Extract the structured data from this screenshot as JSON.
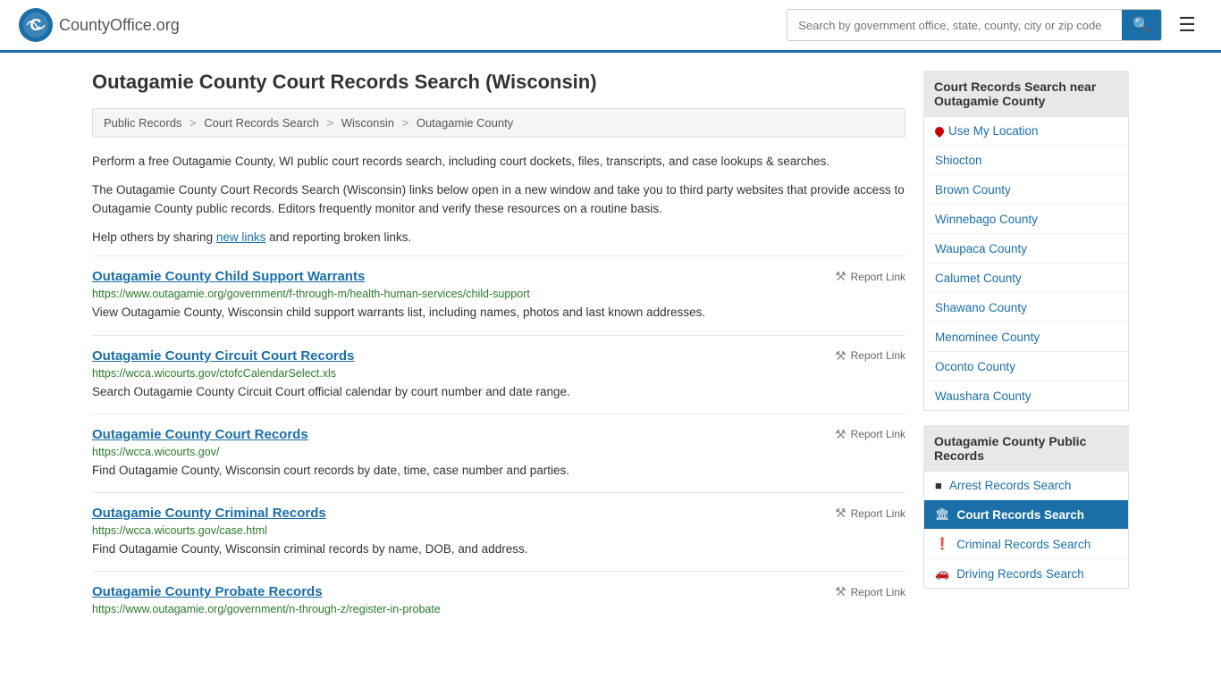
{
  "header": {
    "logo_text": "CountyOffice",
    "logo_suffix": ".org",
    "search_placeholder": "Search by government office, state, county, city or zip code",
    "search_value": ""
  },
  "page": {
    "title": "Outagamie County Court Records Search (Wisconsin)",
    "description1": "Perform a free Outagamie County, WI public court records search, including court dockets, files, transcripts, and case lookups & searches.",
    "description2": "The Outagamie County Court Records Search (Wisconsin) links below open in a new window and take you to third party websites that provide access to Outagamie County public records. Editors frequently monitor and verify these resources on a routine basis.",
    "description3_pre": "Help others by sharing ",
    "description3_link": "new links",
    "description3_post": " and reporting broken links."
  },
  "breadcrumb": {
    "items": [
      "Public Records",
      "Court Records Search",
      "Wisconsin",
      "Outagamie County"
    ]
  },
  "links": [
    {
      "title": "Outagamie County Child Support Warrants",
      "url": "https://www.outagamie.org/government/f-through-m/health-human-services/child-support",
      "description": "View Outagamie County, Wisconsin child support warrants list, including names, photos and last known addresses.",
      "report": "Report Link"
    },
    {
      "title": "Outagamie County Circuit Court Records",
      "url": "https://wcca.wicourts.gov/ctofcCalendarSelect.xls",
      "description": "Search Outagamie County Circuit Court official calendar by court number and date range.",
      "report": "Report Link"
    },
    {
      "title": "Outagamie County Court Records",
      "url": "https://wcca.wicourts.gov/",
      "description": "Find Outagamie County, Wisconsin court records by date, time, case number and parties.",
      "report": "Report Link"
    },
    {
      "title": "Outagamie County Criminal Records",
      "url": "https://wcca.wicourts.gov/case.html",
      "description": "Find Outagamie County, Wisconsin criminal records by name, DOB, and address.",
      "report": "Report Link"
    },
    {
      "title": "Outagamie County Probate Records",
      "url": "https://www.outagamie.org/government/n-through-z/register-in-probate",
      "description": "",
      "report": "Report Link"
    }
  ],
  "sidebar": {
    "nearby_heading": "Court Records Search near Outagamie County",
    "nearby_items": [
      {
        "label": "Use My Location",
        "type": "location"
      },
      {
        "label": "Shiocton"
      },
      {
        "label": "Brown County"
      },
      {
        "label": "Winnebago County"
      },
      {
        "label": "Waupaca County"
      },
      {
        "label": "Calumet County"
      },
      {
        "label": "Shawano County"
      },
      {
        "label": "Menominee County"
      },
      {
        "label": "Oconto County"
      },
      {
        "label": "Waushara County"
      }
    ],
    "records_heading": "Outagamie County Public Records",
    "records_items": [
      {
        "label": "Arrest Records Search",
        "icon": "arrest",
        "active": false
      },
      {
        "label": "Court Records Search",
        "icon": "court",
        "active": true
      },
      {
        "label": "Criminal Records Search",
        "icon": "criminal",
        "active": false
      },
      {
        "label": "Driving Records Search",
        "icon": "driving",
        "active": false
      }
    ]
  }
}
